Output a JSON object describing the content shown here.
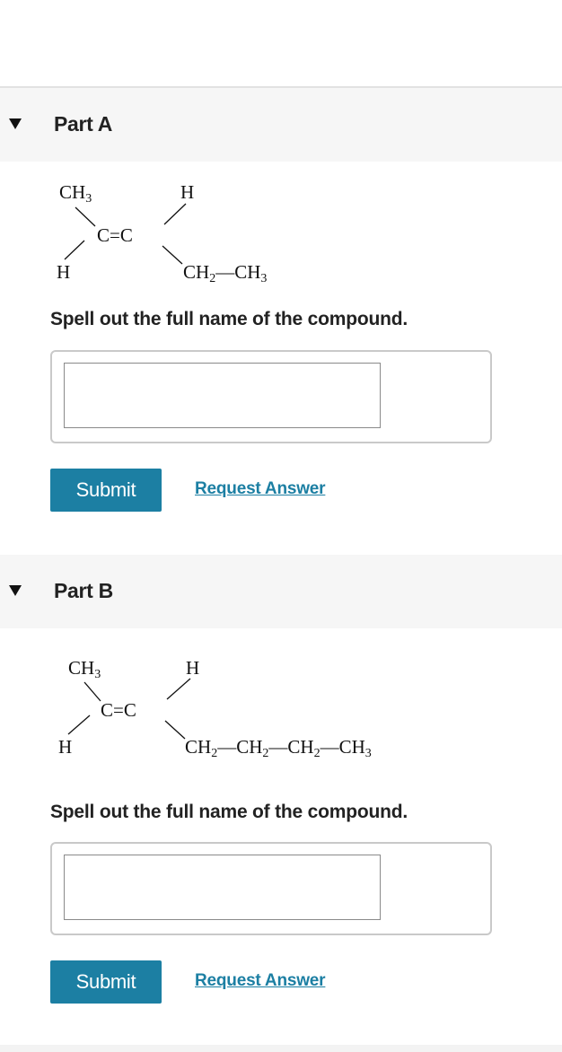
{
  "parts": [
    {
      "title": "Part A",
      "molecule": {
        "top_left": "CH3",
        "top_right": "H",
        "double_bond": "C=C",
        "bottom_left": "H",
        "bottom_right_chain": [
          "CH2",
          "CH3"
        ]
      },
      "prompt": "Spell out the full name of the compound.",
      "answer_value": "",
      "submit_label": "Submit",
      "request_answer_label": "Request Answer"
    },
    {
      "title": "Part B",
      "molecule": {
        "top_left": "CH3",
        "top_right": "H",
        "double_bond": "C=C",
        "bottom_left": "H",
        "bottom_right_chain": [
          "CH2",
          "CH2",
          "CH2",
          "CH3"
        ]
      },
      "prompt": "Spell out the full name of the compound.",
      "answer_value": "",
      "submit_label": "Submit",
      "request_answer_label": "Request Answer"
    }
  ]
}
